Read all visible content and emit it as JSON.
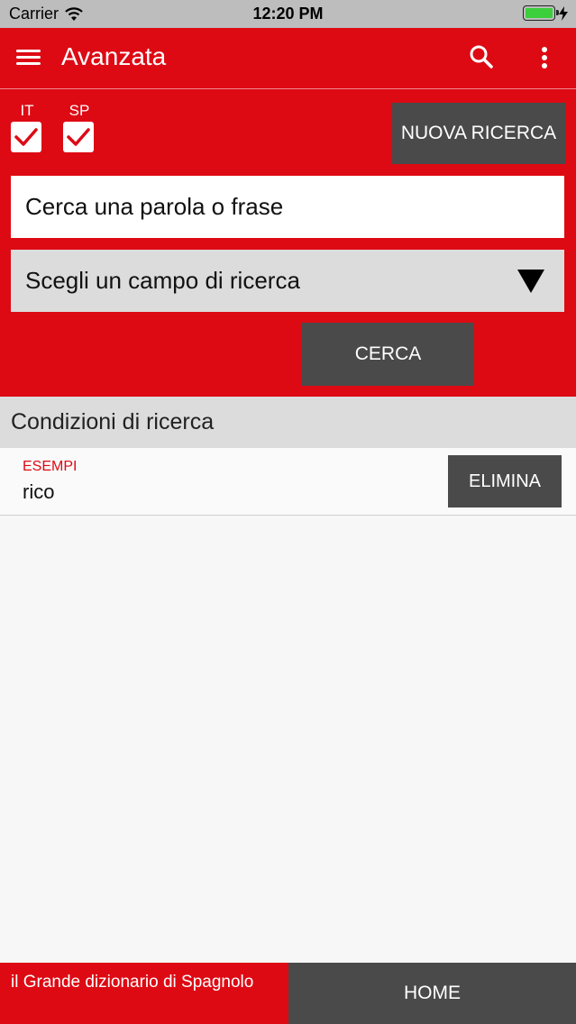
{
  "status_bar": {
    "carrier": "Carrier",
    "time": "12:20 PM"
  },
  "app_bar": {
    "title": "Avanzata",
    "icons": [
      "menu-icon",
      "search-icon",
      "more-vertical-icon"
    ]
  },
  "languages": [
    {
      "label": "IT",
      "checked": true
    },
    {
      "label": "SP",
      "checked": true
    }
  ],
  "new_search_label": "NUOVA RICERCA",
  "search": {
    "placeholder": "Cerca una parola o frase"
  },
  "field_select": {
    "selected": "Scegli un campo di ricerca"
  },
  "search_button_label": "CERCA",
  "conditions": {
    "header": "Condizioni di ricerca",
    "items": [
      {
        "type": "ESEMPI",
        "value": "rico",
        "delete_label": "ELIMINA"
      }
    ]
  },
  "footer": {
    "app_name": "il Grande dizionario di Spagnolo",
    "home_label": "HOME"
  },
  "colors": {
    "accent": "#dd0a14",
    "dark_button": "#4a4a4a"
  }
}
